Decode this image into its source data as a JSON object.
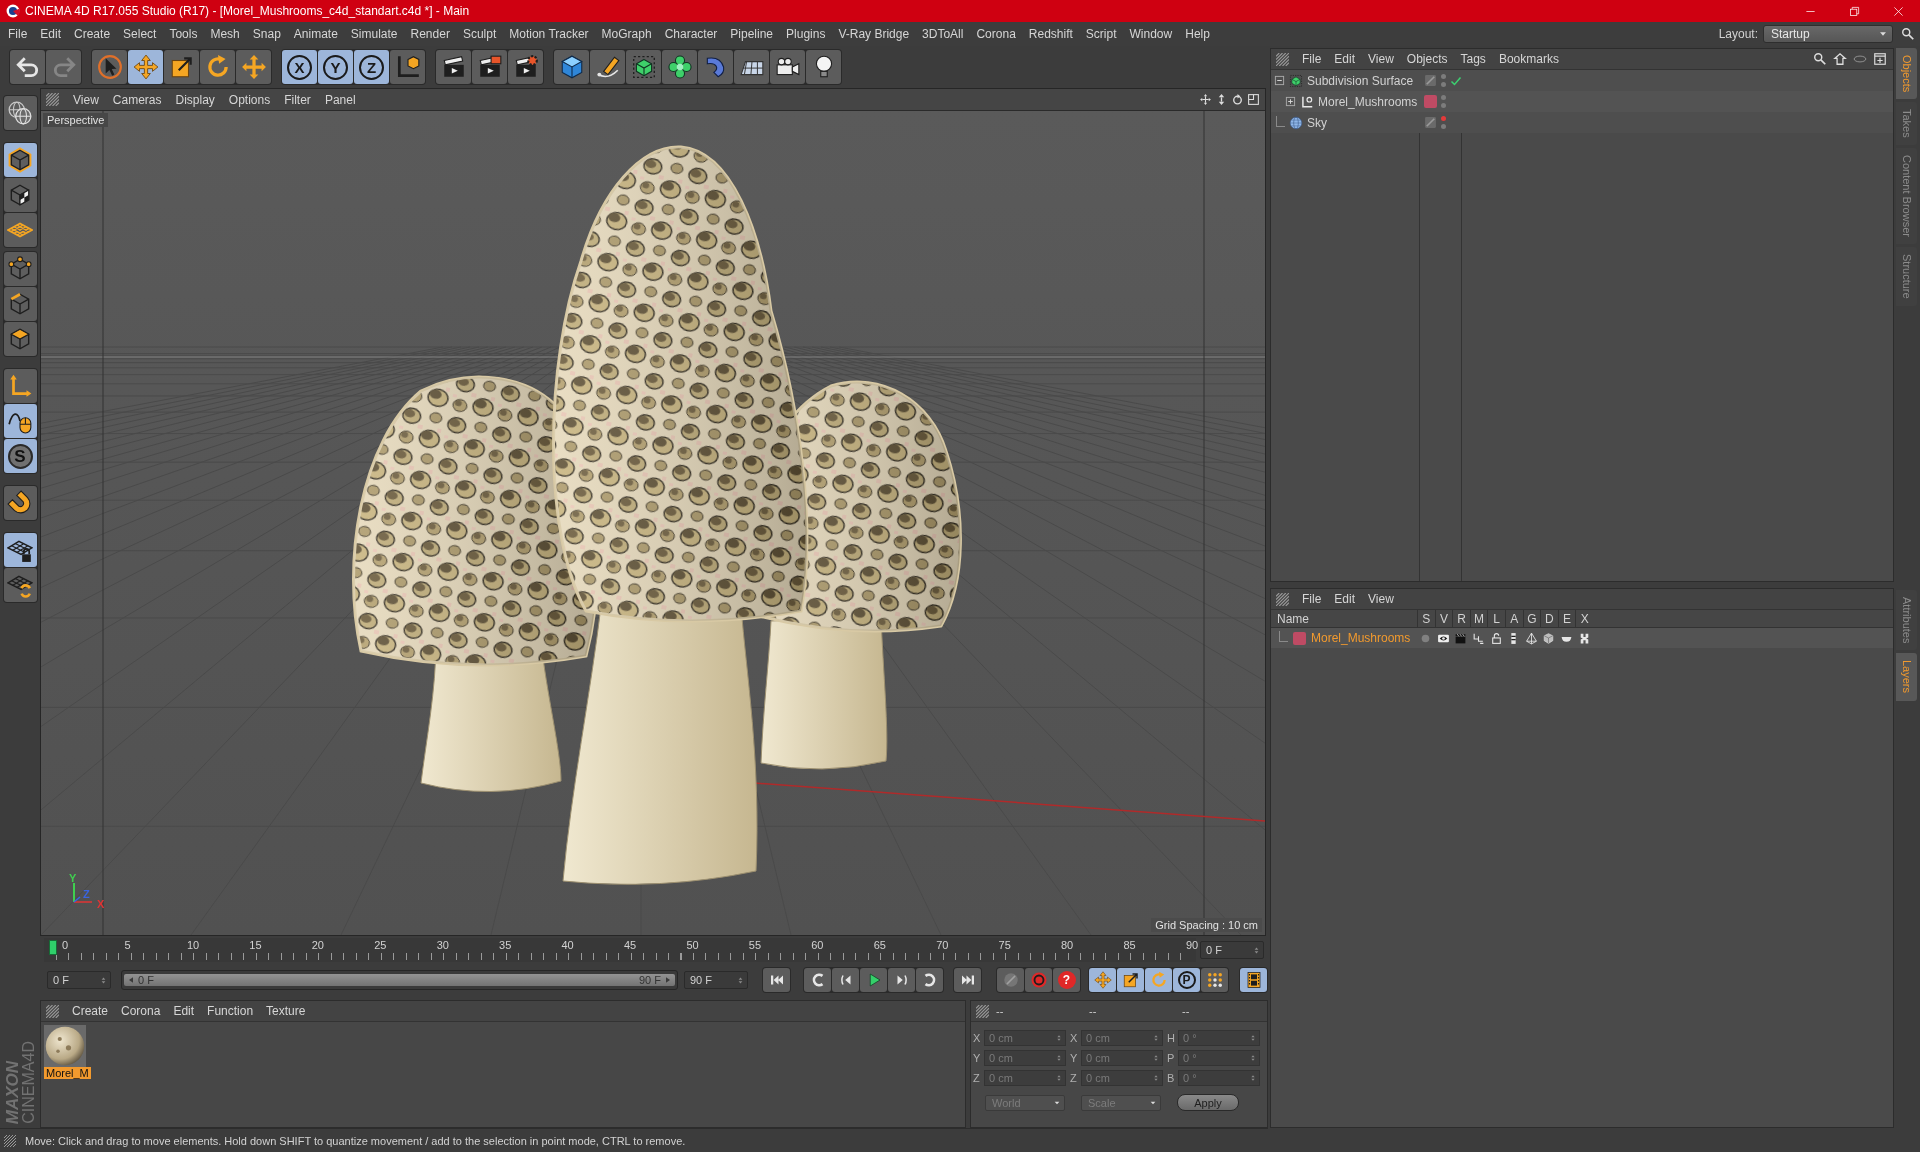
{
  "window": {
    "title": "CINEMA 4D R17.055 Studio (R17) - [Morel_Mushrooms_c4d_standart.c4d *] - Main"
  },
  "menu": [
    "File",
    "Edit",
    "Create",
    "Select",
    "Tools",
    "Mesh",
    "Snap",
    "Animate",
    "Simulate",
    "Render",
    "Sculpt",
    "Motion Tracker",
    "MoGraph",
    "Character",
    "Pipeline",
    "Plugins",
    "V-Ray Bridge",
    "3DToAll",
    "Corona",
    "Redshift",
    "Script",
    "Window",
    "Help"
  ],
  "layout": {
    "label": "Layout:",
    "value": "Startup"
  },
  "toolbar": [
    {
      "items": [
        {
          "kind": "undo",
          "disabled": false
        },
        {
          "kind": "redo",
          "disabled": true
        }
      ]
    },
    {
      "items": [
        {
          "kind": "select",
          "selected": false
        },
        {
          "kind": "move",
          "selected": true
        },
        {
          "kind": "scale",
          "selected": false
        },
        {
          "kind": "rotate",
          "selected": false
        },
        {
          "kind": "transform",
          "selected": false
        }
      ]
    },
    {
      "items": [
        {
          "kind": "axis",
          "label": "X",
          "selected": true
        },
        {
          "kind": "axis",
          "label": "Y",
          "selected": true
        },
        {
          "kind": "axis",
          "label": "Z",
          "selected": true
        },
        {
          "kind": "coordinate_system",
          "selected": false
        }
      ]
    },
    {
      "items": [
        {
          "kind": "render_view"
        },
        {
          "kind": "render_picture"
        },
        {
          "kind": "render_settings"
        }
      ]
    },
    {
      "items": [
        {
          "kind": "cube"
        },
        {
          "kind": "pen"
        },
        {
          "kind": "subdivision"
        },
        {
          "kind": "cloner"
        },
        {
          "kind": "deformer"
        },
        {
          "kind": "floor"
        },
        {
          "kind": "camera"
        },
        {
          "kind": "light"
        }
      ]
    }
  ],
  "left_tools": [
    {
      "items": [
        {
          "kind": "make_editable"
        }
      ]
    },
    {
      "items": [
        {
          "kind": "model",
          "selected": true
        },
        {
          "kind": "texture",
          "selected": false
        },
        {
          "kind": "workplane",
          "selected": false
        }
      ]
    },
    {
      "items": [
        {
          "kind": "points",
          "selected": false
        },
        {
          "kind": "edges",
          "selected": false
        },
        {
          "kind": "polygons",
          "selected": false
        }
      ]
    },
    {
      "items": [
        {
          "kind": "axis_mode",
          "selected": false
        },
        {
          "kind": "tweak",
          "selected": true
        },
        {
          "kind": "solo",
          "label": "S",
          "selected": true
        }
      ]
    },
    {
      "items": [
        {
          "kind": "snap"
        }
      ]
    },
    {
      "items": [
        {
          "kind": "workplane_lock",
          "selected": true
        },
        {
          "kind": "workplane_align",
          "selected": false
        }
      ]
    }
  ],
  "viewport": {
    "menu": [
      "View",
      "Cameras",
      "Display",
      "Options",
      "Filter",
      "Panel"
    ],
    "camera": "Perspective",
    "axis_labels": [
      "Y",
      "Z",
      "X"
    ],
    "grid_spacing": "Grid Spacing : 10 cm"
  },
  "timeline": {
    "ticks": [
      "0",
      "5",
      "10",
      "15",
      "20",
      "25",
      "30",
      "35",
      "40",
      "45",
      "50",
      "55",
      "60",
      "65",
      "70",
      "75",
      "80",
      "85",
      "90"
    ],
    "level": 0,
    "frame_field": "0 F"
  },
  "transport": {
    "start_field": "0 F",
    "range": {
      "start": "0 F",
      "end": "90 F",
      "level": 1
    },
    "end_field": "90 F",
    "playback": [
      {
        "kind": "first"
      },
      {
        "kind": "prev_key"
      },
      {
        "kind": "prev_frame"
      },
      {
        "kind": "play"
      },
      {
        "kind": "next_frame"
      },
      {
        "kind": "next_key"
      },
      {
        "kind": "last"
      }
    ],
    "record": [
      {
        "kind": "autokey"
      },
      {
        "kind": "record"
      },
      {
        "kind": "key_help",
        "label": "?"
      }
    ],
    "keys": [
      {
        "kind": "key_position",
        "selected": true
      },
      {
        "kind": "key_scale",
        "selected": true
      },
      {
        "kind": "key_rotation",
        "selected": true
      },
      {
        "kind": "key_parameter",
        "label": "P",
        "selected": true
      },
      {
        "kind": "key_points",
        "selected": false
      }
    ],
    "extra": [
      {
        "kind": "timeline",
        "selected": true
      }
    ]
  },
  "material_manager": {
    "menu": [
      "Create",
      "Corona",
      "Edit",
      "Function",
      "Texture"
    ],
    "materials": [
      {
        "name": "Morel_M",
        "selected": true
      }
    ]
  },
  "coordinates": {
    "headers": [
      "--",
      "--",
      "--"
    ],
    "disabled": true,
    "rows": [
      {
        "cells": [
          {
            "axis": "X",
            "value": "0 cm"
          },
          {
            "axis": "X",
            "value": "0 cm"
          },
          {
            "axis": "H",
            "value": "0 °"
          }
        ]
      },
      {
        "cells": [
          {
            "axis": "Y",
            "value": "0 cm"
          },
          {
            "axis": "Y",
            "value": "0 cm"
          },
          {
            "axis": "P",
            "value": "0 °"
          }
        ]
      },
      {
        "cells": [
          {
            "axis": "Z",
            "value": "0 cm"
          },
          {
            "axis": "Z",
            "value": "0 cm"
          },
          {
            "axis": "B",
            "value": "0 °"
          }
        ]
      }
    ],
    "dropdowns": [
      "World",
      "Scale"
    ],
    "apply": "Apply"
  },
  "logo": [
    "MAXON",
    "CINEMA4D"
  ],
  "status_bar": "Move: Click and drag to move elements. Hold down SHIFT to quantize movement / add to the selection in point mode, CTRL to remove.",
  "object_manager": {
    "menu": [
      "File",
      "Edit",
      "View",
      "Objects",
      "Tags",
      "Bookmarks"
    ],
    "objects": [
      {
        "name": "Subdivision Surface",
        "kind": "subdivision",
        "expanded": true,
        "editor_visible": true,
        "render_visible": true,
        "enabled": true,
        "children": [
          {
            "name": "Morel_Mushrooms",
            "kind": "null",
            "expanded": false,
            "color": "#bf4b64",
            "editor_visible": true,
            "render_visible": true
          }
        ]
      },
      {
        "name": "Sky",
        "kind": "sky",
        "editor_visible": false,
        "render_visible": true
      }
    ]
  },
  "layer_manager": {
    "menu": [
      "File",
      "Edit",
      "View"
    ],
    "columns": [
      "Name",
      "S",
      "V",
      "R",
      "M",
      "L",
      "A",
      "G",
      "D",
      "E",
      "X"
    ],
    "layers": [
      {
        "name": "Morel_Mushrooms",
        "color": "#bf4b64",
        "flags": [
          {
            "kind": "solo"
          },
          {
            "kind": "visible"
          },
          {
            "kind": "render"
          },
          {
            "kind": "manager"
          },
          {
            "kind": "locked"
          },
          {
            "kind": "animation"
          },
          {
            "kind": "generators"
          },
          {
            "kind": "deformers"
          },
          {
            "kind": "expressions"
          },
          {
            "kind": "xref"
          }
        ]
      }
    ]
  },
  "side_tabs": {
    "upper": [
      {
        "label": "Objects",
        "selected": true
      },
      {
        "label": "Takes",
        "selected": false
      },
      {
        "label": "Content Browser",
        "selected": false
      },
      {
        "label": "Structure",
        "selected": false
      }
    ],
    "lower": [
      {
        "label": "Attributes",
        "selected": false
      },
      {
        "label": "Layers",
        "selected": true
      }
    ]
  }
}
